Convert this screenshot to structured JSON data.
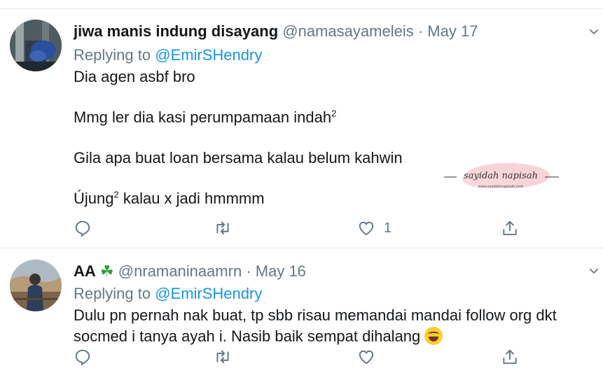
{
  "tweets": [
    {
      "display_name": "jiwa manis indung disayang",
      "handle": "@namasayameleis",
      "separator": "·",
      "date": "May 17",
      "replying_prefix": "Replying to",
      "replying_to": "@EmirSHendry",
      "lines": [
        {
          "text": "Dia agen asbf bro"
        },
        {
          "text": "Mmg ler dia kasi perumpamaan indah",
          "sup": "2"
        },
        {
          "text": "Gila apa buat loan bersama kalau belum kahwin"
        },
        {
          "pre": "Újung",
          "sup": "2",
          "text": " kalau x jadi hmmmm"
        }
      ],
      "like_count": "1",
      "icons": {
        "reply": "reply-icon",
        "retweet": "retweet-icon",
        "like": "heart-icon",
        "share": "share-icon",
        "menu": "chevron-down-icon"
      }
    },
    {
      "display_name": "AA",
      "emoji_after_name": "☘",
      "handle": "@nramaninaamrn",
      "separator": "·",
      "date": "May 16",
      "replying_prefix": "Replying to",
      "replying_to": "@EmirSHendry",
      "lines": [
        {
          "text": "Dulu pn pernah nak buat, tp sbb risau memandai mandai follow org dkt"
        },
        {
          "text": "socmed i tanya ayah i. Nasib baik sempat dihalang",
          "emoji": "face-with-tears-of-joy"
        }
      ],
      "like_count": "",
      "icons": {
        "reply": "reply-icon",
        "retweet": "retweet-icon",
        "like": "heart-icon",
        "share": "share-icon",
        "menu": "chevron-down-icon"
      }
    }
  ],
  "watermark": {
    "text": "sayidah napisah",
    "subtext": "www.sayidahnapisah.com"
  },
  "colors": {
    "text": "#14171a",
    "muted": "#657786",
    "link": "#1b95e0",
    "divider": "#e6ecf0",
    "clover": "#2e9e3f"
  }
}
